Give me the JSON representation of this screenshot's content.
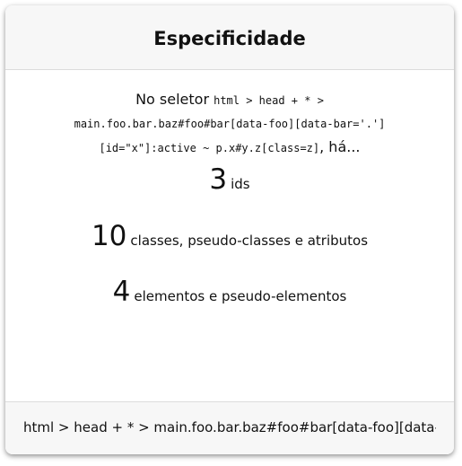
{
  "card": {
    "title": "Especificidade",
    "intro": {
      "prefix": "No seletor",
      "code_line1": "html > head + * >",
      "code_line2": "main.foo.bar.baz#foo#bar[data-foo][data-bar='.']",
      "code_line3": "[id=\"x\"]:active ~ p.x#y.z[class=z]",
      "suffix": ", há..."
    },
    "stats": [
      {
        "value": "3",
        "label": "ids"
      },
      {
        "value": "10",
        "label": "classes, pseudo-classes e atributos"
      },
      {
        "value": "4",
        "label": "elementos e pseudo-elementos"
      }
    ],
    "footer_input": "html > head + * > main.foo.bar.baz#foo#bar[data-foo][data-bar='.'][id=\"x\"]:active ~ p.x#y.z[class=z]"
  }
}
